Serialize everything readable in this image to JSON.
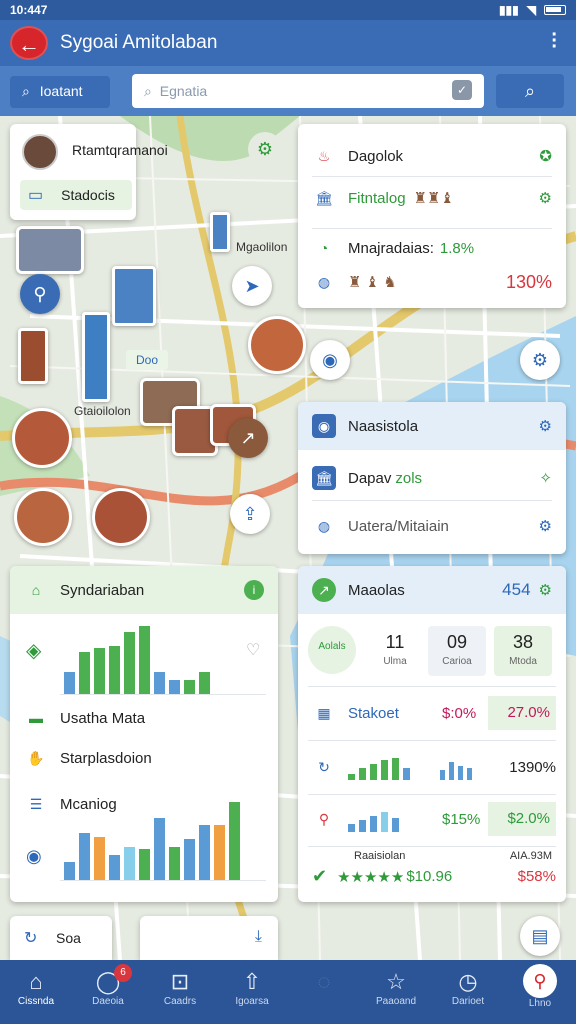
{
  "status": {
    "time": "10:447"
  },
  "appbar": {
    "back_icon": "arrow-left-icon",
    "title": "Sygoai Amitolaban"
  },
  "search": {
    "button_label": "Ioatant",
    "placeholder": "Egnatia"
  },
  "profile": {
    "name": "Rtamtqramanoi",
    "button_label": "Stadocis"
  },
  "map_labels": {
    "label1": "Mgaolilon",
    "label2": "Doo",
    "label3": "Gtaioilolon"
  },
  "info_card": {
    "rows": [
      {
        "label": "Dagolok"
      },
      {
        "label": "Fitntalog"
      },
      {
        "label": "Mnajradaias:",
        "value": "1.8%"
      },
      {
        "label": "",
        "value": "130%"
      }
    ]
  },
  "nav_card": {
    "rows": [
      {
        "label": "Naasistola"
      },
      {
        "label": "Dapav",
        "accent": "zols"
      },
      {
        "label": "Uatera/Mitaiain"
      }
    ]
  },
  "left_panel": {
    "header": "Syndariaban",
    "chart1": {
      "values": [
        22,
        42,
        46,
        48,
        62,
        68,
        22,
        14,
        14,
        22
      ]
    },
    "item1": "Usatha Mata",
    "item2": "Starplasdoion",
    "item3": "Mcaniog",
    "chart2": {
      "values": [
        18,
        46,
        42,
        24,
        32,
        30,
        60,
        32,
        40,
        54,
        54,
        76
      ]
    }
  },
  "right_panel": {
    "header": "Maaolas",
    "header_value": "454",
    "stats": [
      {
        "label": "Aolals",
        "value": ""
      },
      {
        "label": "Ulma",
        "value": "11"
      },
      {
        "label": "Carioa",
        "value": "09"
      },
      {
        "label": "Mtoda",
        "value": "38"
      }
    ],
    "rows": [
      {
        "label": "Stakoet",
        "v1": "$:0%",
        "v2": "27.0%"
      },
      {
        "label": "",
        "v1": "",
        "v2": "1390%"
      },
      {
        "label": "",
        "v1": "$15%",
        "v2": "$2.0%"
      }
    ],
    "footer_left": "Raaisiolan",
    "footer_right": "AIA.93M",
    "rating_value": "$10.96",
    "rating_stars": 5,
    "footer_value": "$58%"
  },
  "bottom_card": {
    "label": "Soa"
  },
  "nav": {
    "items": [
      {
        "label": "Cissnda",
        "icon": "home-icon"
      },
      {
        "label": "Daeoia",
        "icon": "search-icon",
        "badge": "6"
      },
      {
        "label": "Caadrs",
        "icon": "car-icon"
      },
      {
        "label": "Igoarsa",
        "icon": "arrow-icon"
      },
      {
        "label": "",
        "icon": "blank-icon"
      },
      {
        "label": "Paaoand",
        "icon": "star-icon"
      },
      {
        "label": "Darioet",
        "icon": "clock-icon"
      },
      {
        "label": "Lhno",
        "icon": "pin-icon"
      }
    ]
  },
  "colors": {
    "accent": "#3a6cb5",
    "danger": "#d6262b",
    "success": "#2e9a3a",
    "nav": "#2b5596"
  }
}
